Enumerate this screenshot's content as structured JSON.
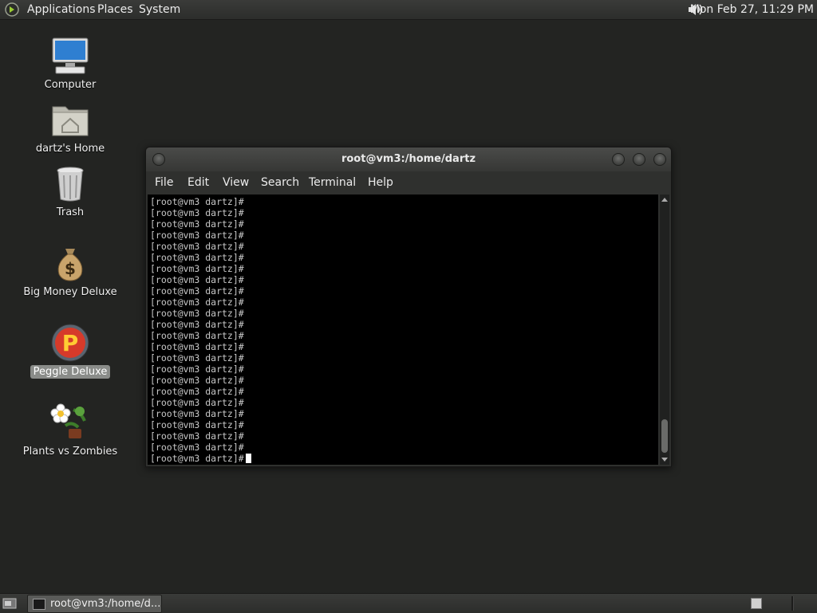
{
  "top_panel": {
    "applications": "Applications",
    "places": "Places",
    "system": "System",
    "clock": "Mon Feb 27, 11:29 PM"
  },
  "desktop": {
    "icons": [
      {
        "label": "Computer",
        "icon": "computer-icon"
      },
      {
        "label": "dartz's Home",
        "icon": "home-folder-icon"
      },
      {
        "label": "Trash",
        "icon": "trash-icon"
      },
      {
        "label": "Big Money Deluxe",
        "icon": "money-bag-icon"
      },
      {
        "label": "Peggle Deluxe",
        "icon": "peggle-icon",
        "selected": true
      },
      {
        "label": "Plants vs Zombies",
        "icon": "plants-vs-zombies-icon"
      }
    ]
  },
  "terminal": {
    "title": "root@vm3:/home/dartz",
    "menu": [
      "File",
      "Edit",
      "View",
      "Search",
      "Terminal",
      "Help"
    ],
    "prompt": "[root@vm3 dartz]#",
    "line_count": 24
  },
  "taskbar": {
    "task_label": "root@vm3:/home/d..."
  },
  "colors": {
    "desktop_bg": "#232422",
    "panel_bg": "#333432",
    "terminal_bg": "#000000",
    "selected_label_bg": "#8a8c89"
  }
}
